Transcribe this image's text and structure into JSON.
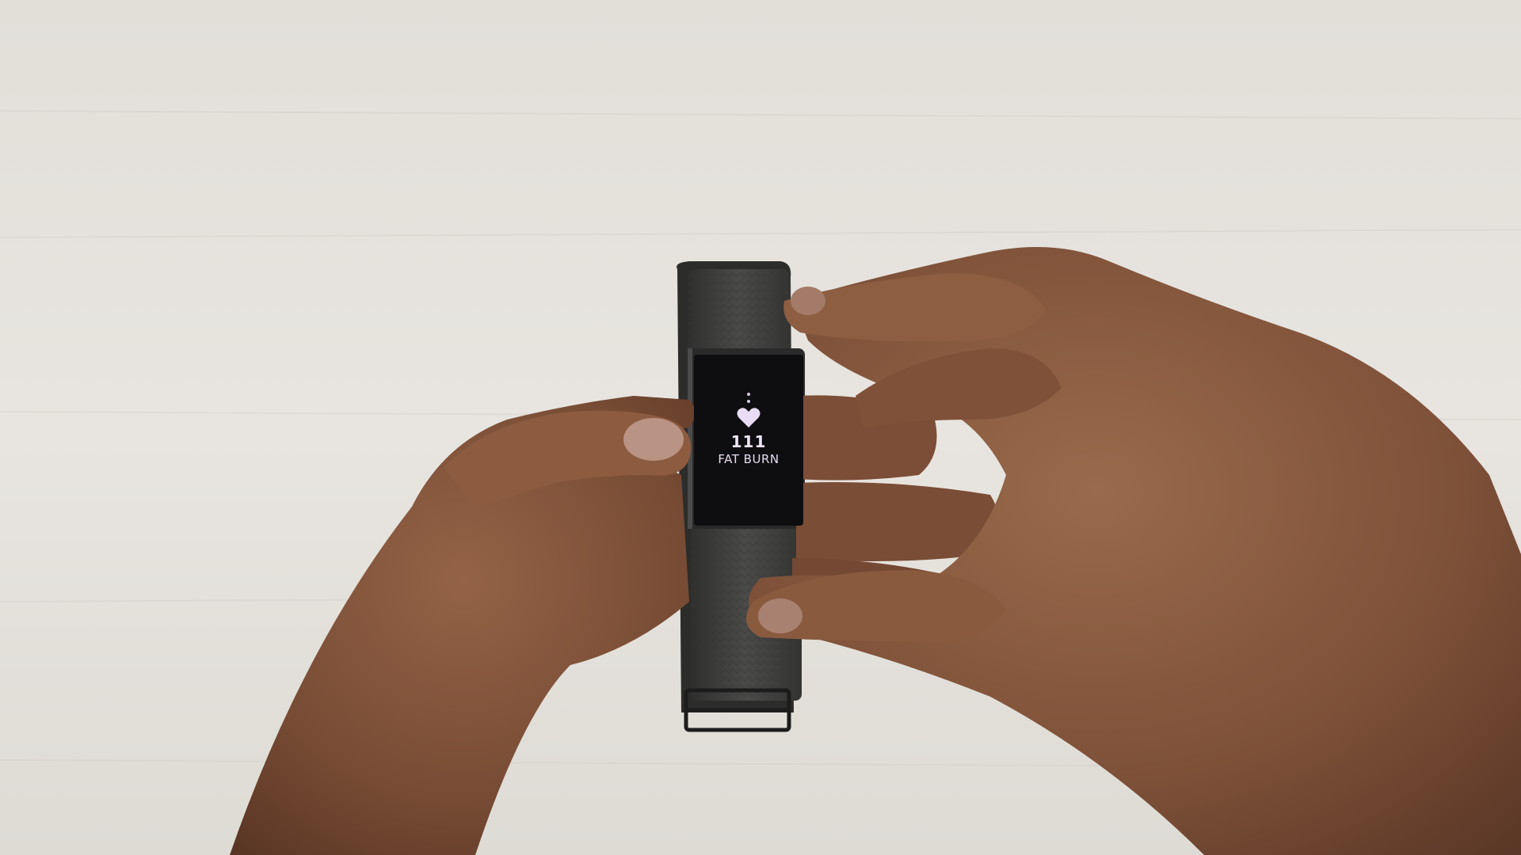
{
  "tracker_display": {
    "heart_rate_value": "111",
    "heart_rate_zone": "FAT BURN",
    "icon": "heart-icon",
    "page_indicator_icon": "vertical-dots-icon",
    "text_color": "#efe6f7"
  },
  "colors": {
    "background": "#e4e1dc",
    "band": "#3f3f3d",
    "screen": "#0e0e10",
    "skin": "#8a5a3f"
  }
}
